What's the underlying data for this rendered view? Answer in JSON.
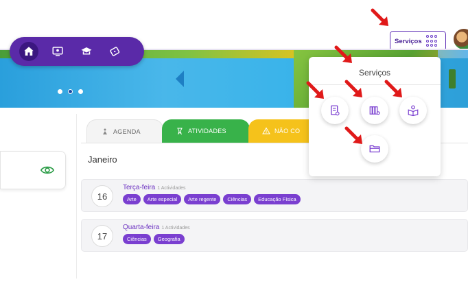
{
  "header": {
    "services_label": "Serviços"
  },
  "nav": {
    "items": [
      {
        "icon": "home-icon"
      },
      {
        "icon": "monitor-icon"
      },
      {
        "icon": "graduation-cap-icon"
      },
      {
        "icon": "tickets-icon"
      }
    ]
  },
  "services_menu": {
    "title": "Serviços",
    "items": [
      {
        "icon": "document-icon"
      },
      {
        "icon": "library-search-icon"
      },
      {
        "icon": "reading-icon"
      },
      {
        "icon": "folder-icon"
      }
    ]
  },
  "tabs": [
    {
      "label": "AGENDA"
    },
    {
      "label": "ATIVIDADES"
    },
    {
      "label": "NÃO CO"
    }
  ],
  "agenda": {
    "month": "Janeiro",
    "days": [
      {
        "number": "16",
        "name": "Terça-feira",
        "count": "1 Actividades",
        "tags": [
          "Arte",
          "Arte especial",
          "Arte regente",
          "Ciências",
          "Educação Física"
        ]
      },
      {
        "number": "17",
        "name": "Quarta-feira",
        "count": "1 Actividades",
        "tags": [
          "Ciências",
          "Geografia"
        ]
      }
    ]
  },
  "colors": {
    "brand_purple": "#5a2aa8",
    "tag_purple": "#7a3fd0",
    "tab_green": "#38b24a",
    "tab_yellow": "#f5c21b",
    "annotation_red": "#e01919"
  }
}
